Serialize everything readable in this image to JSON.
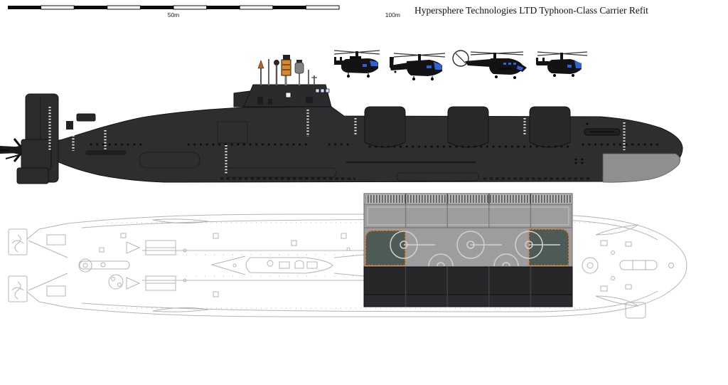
{
  "header": {
    "title": "Hypersphere Technologies LTD Typhoon-Class Carrier Refit"
  },
  "scale_bar": {
    "label_mid": "50m",
    "label_end": "100m"
  },
  "colors": {
    "hull": "#2e2e31",
    "hangar": "#28282b",
    "sail": "#2b2b2e",
    "fin": "#2c2c2f",
    "sonar_dome": "#8f8f91",
    "deck_gray": "#9d9d9f",
    "deck_hatch_bg": "#b9b9bb",
    "deck_dark": "#27272a",
    "deck_dark_lower": "#2b2b2f",
    "elevator_fill": "#4d5a56",
    "elevator_border": "#e67e22",
    "helipad_marking": "#d2d2d4",
    "heli_body": "#131316",
    "heli_window": "#2e62d9",
    "mast_box_orange": "#d8882a",
    "scale_black": "#0a0a0a"
  }
}
